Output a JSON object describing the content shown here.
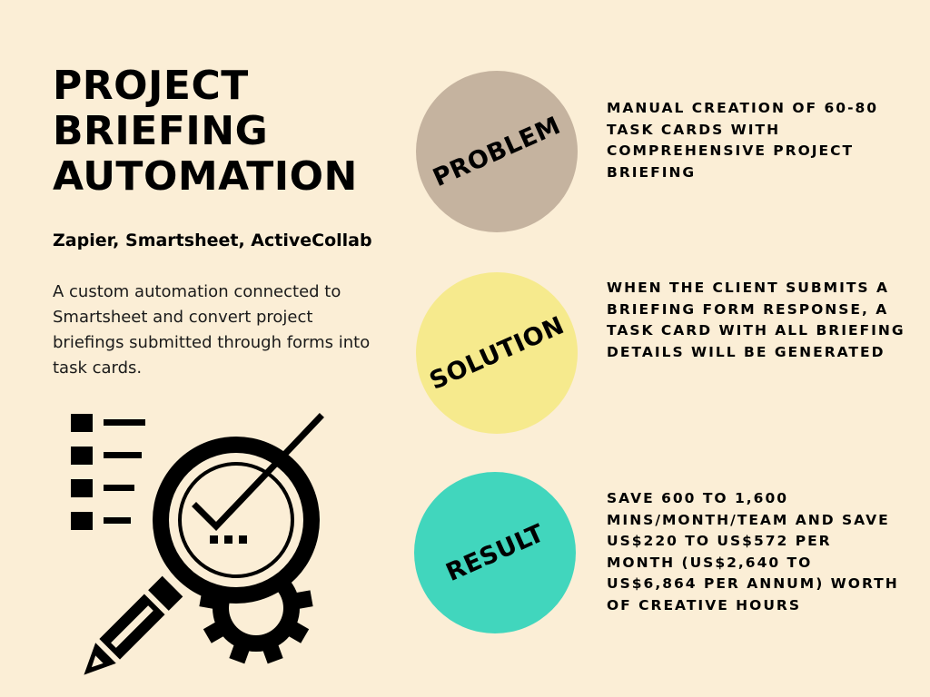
{
  "title": {
    "line1": "PROJECT",
    "line2": "BRIEFING",
    "line3": "AUTOMATION"
  },
  "tools": "Zapier, Smartsheet, ActiveCollab",
  "description": "A custom automation connected to Smartsheet and convert project briefings submitted through forms into task cards.",
  "illustration": {
    "icon": "checklist-magnifier-pencil-gear-icon"
  },
  "sections": {
    "problem": {
      "label": "PROBLEM",
      "color": "#c5b39f",
      "text": "MANUAL CREATION OF 60-80 TASK CARDS WITH COMPREHENSIVE PROJECT BRIEFING"
    },
    "solution": {
      "label": "SOLUTION",
      "color": "#f6ea8d",
      "text": "WHEN THE CLIENT SUBMITS A BRIEFING FORM RESPONSE, A TASK CARD WITH ALL BRIEFING DETAILS WILL BE GENERATED"
    },
    "result": {
      "label": "RESULT",
      "color": "#41d6bd",
      "text": "SAVE 600 TO 1,600 MINS/MONTH/TEAM AND SAVE US$220 TO US$572 PER MONTH (US$2,640 TO US$6,864 PER ANNUM) WORTH OF CREATIVE HOURS"
    }
  },
  "colors": {
    "background": "#fbeed6",
    "text": "#000000"
  }
}
